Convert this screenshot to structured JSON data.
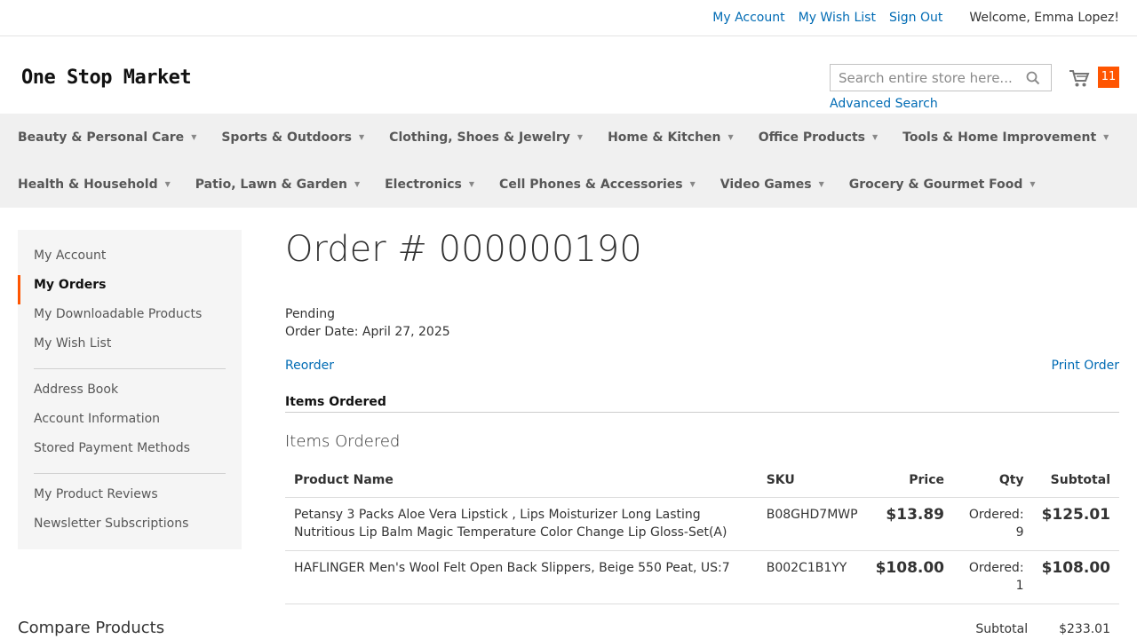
{
  "top": {
    "my_account": "My Account",
    "wish_list": "My Wish List",
    "sign_out": "Sign Out",
    "welcome": "Welcome, Emma Lopez!"
  },
  "header": {
    "logo": "One Stop Market",
    "search_placeholder": "Search entire store here...",
    "advanced_search": "Advanced Search",
    "cart_count": "11"
  },
  "nav": {
    "row1": [
      "Beauty & Personal Care",
      "Sports & Outdoors",
      "Clothing, Shoes & Jewelry",
      "Home & Kitchen",
      "Office Products",
      "Tools & Home Improvement"
    ],
    "row2": [
      "Health & Household",
      "Patio, Lawn & Garden",
      "Electronics",
      "Cell Phones & Accessories",
      "Video Games",
      "Grocery & Gourmet Food"
    ]
  },
  "sidebar": {
    "group1": [
      "My Account",
      "My Orders",
      "My Downloadable Products",
      "My Wish List"
    ],
    "group2": [
      "Address Book",
      "Account Information",
      "Stored Payment Methods"
    ],
    "group3": [
      "My Product Reviews",
      "Newsletter Subscriptions"
    ],
    "compare": "Compare Products"
  },
  "order": {
    "title": "Order # 000000190",
    "status": "Pending",
    "date": "Order Date: April 27, 2025",
    "reorder": "Reorder",
    "print": "Print Order",
    "tab": "Items Ordered",
    "section": "Items Ordered",
    "columns": [
      "Product Name",
      "SKU",
      "Price",
      "Qty",
      "Subtotal"
    ],
    "items": [
      {
        "name": "Petansy 3 Packs Aloe Vera Lipstick , Lips Moisturizer Long Lasting Nutritious Lip Balm Magic Temperature Color Change Lip Gloss-Set(A)",
        "sku": "B08GHD7MWP",
        "price": "$13.89",
        "qty": "Ordered: 9",
        "subtotal": "$125.01"
      },
      {
        "name": "HAFLINGER Men's Wool Felt Open Back Slippers, Beige 550 Peat, US:7",
        "sku": "B002C1B1YY",
        "price": "$108.00",
        "qty": "Ordered: 1",
        "subtotal": "$108.00"
      }
    ],
    "subtotal_label": "Subtotal",
    "subtotal_value": "$233.01"
  }
}
